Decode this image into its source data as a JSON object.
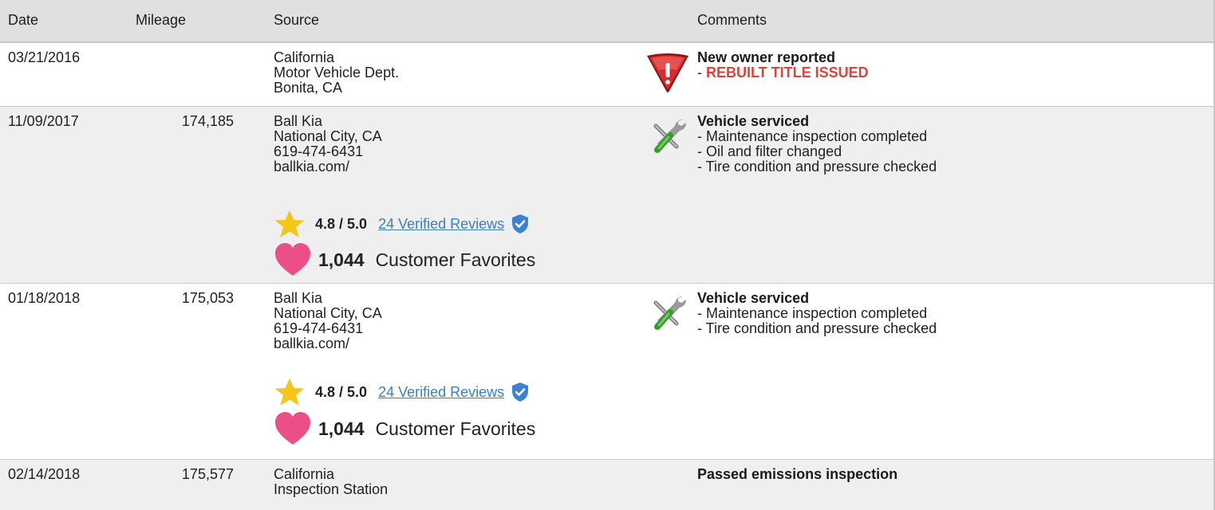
{
  "header": {
    "date": "Date",
    "mileage": "Mileage",
    "source": "Source",
    "comments": "Comments"
  },
  "rows": [
    {
      "date": "03/21/2016",
      "mileage": "",
      "source": [
        "California",
        "Motor Vehicle Dept.",
        "Bonita, CA"
      ],
      "icon": "warning-icon",
      "comment_title": "New owner reported",
      "comment_prefix": "- ",
      "comment_alert": "REBUILT TITLE ISSUED"
    },
    {
      "date": "11/09/2017",
      "mileage": "174,185",
      "source": [
        "Ball Kia",
        "National City, CA",
        "619-474-6431",
        "ballkia.com/"
      ],
      "rating_score": "4.8 / 5.0",
      "rating_reviews": "24 Verified Reviews",
      "favorites_count": "1,044",
      "favorites_label": "Customer Favorites",
      "icon": "service-tools-icon",
      "comment_title": "Vehicle serviced",
      "comment_lines": [
        "- Maintenance inspection completed",
        "- Oil and filter changed",
        "- Tire condition and pressure checked"
      ]
    },
    {
      "date": "01/18/2018",
      "mileage": "175,053",
      "source": [
        "Ball Kia",
        "National City, CA",
        "619-474-6431",
        "ballkia.com/"
      ],
      "rating_score": "4.8 / 5.0",
      "rating_reviews": "24 Verified Reviews",
      "favorites_count": "1,044",
      "favorites_label": "Customer Favorites",
      "icon": "service-tools-icon",
      "comment_title": "Vehicle serviced",
      "comment_lines": [
        "- Maintenance inspection completed",
        "- Tire condition and pressure checked"
      ]
    },
    {
      "date": "02/14/2018",
      "mileage": "175,577",
      "source": [
        "California",
        "Inspection Station"
      ],
      "comment_title": "Passed emissions inspection"
    }
  ],
  "colors": {
    "alert": "#e0423a",
    "link": "#3a7fc6",
    "star": "#f5c518",
    "heart": "#ec4f88",
    "shield": "#3b82d6",
    "header_bg": "#e0e0e0",
    "alt_row_bg": "#efefef"
  }
}
